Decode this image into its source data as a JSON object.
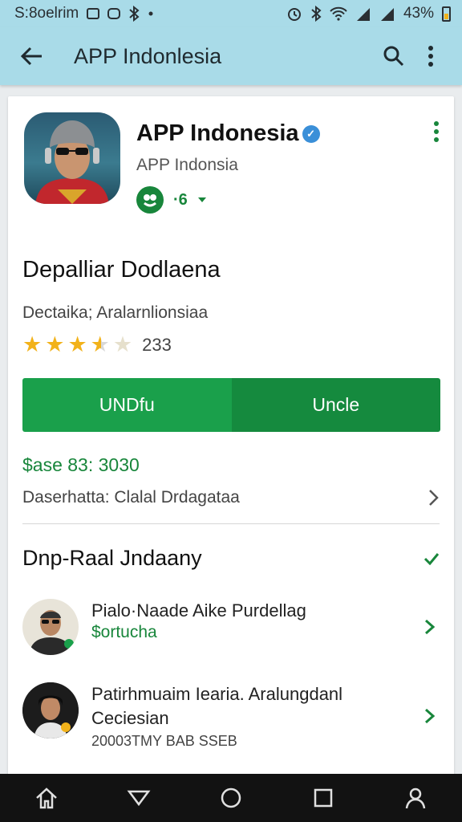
{
  "status_bar": {
    "left_text": "S:8oelrim",
    "battery_text": "43%"
  },
  "app_bar": {
    "title": "APP Indonlesia",
    "icons": [
      "back-arrow-icon",
      "search-icon",
      "more-vert-icon"
    ]
  },
  "app_info": {
    "name": "APP Indonesia",
    "developer": "APP Indonsia",
    "badge_text": "·6"
  },
  "details": {
    "title": "Depalliar Dodlaena",
    "subtitle": "Dectaika; Aralarnlionsiaa",
    "rating_value": 3.5,
    "rating_max": 5,
    "rating_count": "233"
  },
  "actions": {
    "primary_label": "UNDfu",
    "secondary_label": "Uncle"
  },
  "price_line": "$ase 83: 3030",
  "developer_line": "Daserhatta: Clalal Drdagataa",
  "section": {
    "title": "Dnp-Raal Jndaany"
  },
  "list": [
    {
      "title": "Pialo·Naade Aike Purdellag",
      "subtitle": "$ortucha",
      "meta": ""
    },
    {
      "title": "Patirhmuaim Iearia. Aralungdanl Ceciesian",
      "subtitle": "",
      "meta": "20003TMY BAB SSEB"
    }
  ],
  "colors": {
    "app_bar": "#a9dbe8",
    "accent_green": "#1aa04b",
    "dark_green": "#158a3e",
    "star": "#f2b21a",
    "verified_blue": "#3a8fd8"
  }
}
